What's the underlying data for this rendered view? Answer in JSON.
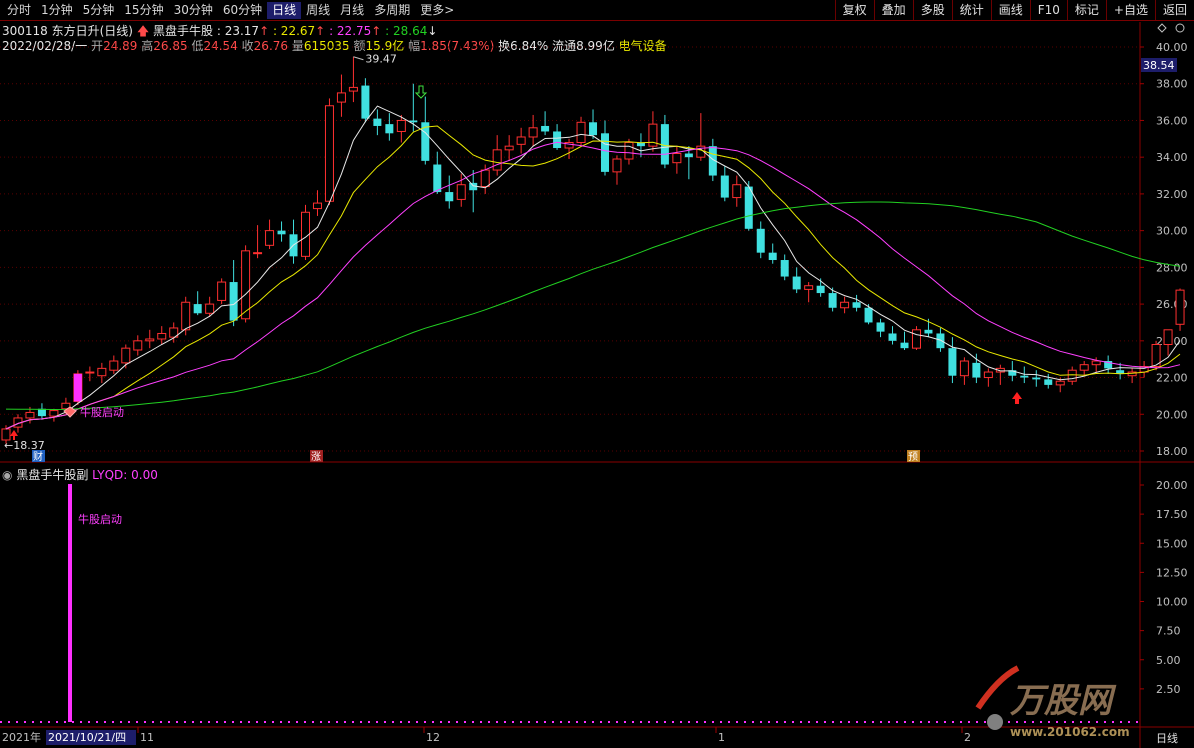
{
  "toolbar": {
    "periods": [
      "分时",
      "1分钟",
      "5分钟",
      "15分钟",
      "30分钟",
      "60分钟",
      "日线",
      "周线",
      "月线",
      "多周期",
      "更多>"
    ],
    "active_period": "日线",
    "actions": [
      "复权",
      "叠加",
      "多股",
      "统计",
      "画线",
      "F10",
      "标记",
      "+自选",
      "返回"
    ]
  },
  "stock": {
    "code_name": "300118 东方日升(日线)",
    "indicator_name": "黑盘手牛股",
    "v1": ": 23.17",
    "v2": ": 22.67",
    "v3": ": 22.75",
    "v4": ": 28.64"
  },
  "quote": {
    "date": "2022/02/28/一",
    "open_label": "开",
    "open": "24.89",
    "high_label": "高",
    "high": "26.85",
    "low_label": "低",
    "low": "24.54",
    "close_label": "收",
    "close": "26.76",
    "vol_label": "量",
    "vol": "615035",
    "amt_label": "额",
    "amt": "15.9亿",
    "chg_label": "幅",
    "chg": "1.85(7.43%)",
    "turnover": "换6.84%",
    "float": "流通8.99亿",
    "sector": "电气设备"
  },
  "main_chart": {
    "y_ticks": [
      "40.00",
      "38.00",
      "36.00",
      "34.00",
      "32.00",
      "30.00",
      "28.00",
      "26.00",
      "24.00",
      "22.00",
      "20.00",
      "18.00"
    ],
    "current_price": "38.54",
    "high_label": "39.47",
    "low_label": "18.37",
    "signal_label": "牛股启动",
    "markers": [
      "财",
      "涨",
      "预"
    ],
    "colors": {
      "up": "#ff3030",
      "down": "#40e0e0",
      "ma5": "#e8e8e8",
      "ma10": "#e8e800",
      "ma20": "#ff40ff",
      "ma60": "#22d022"
    }
  },
  "sub_chart": {
    "title": "黑盘手牛股副",
    "value_label": "LYQD: 0.00",
    "signal_label": "牛股启动",
    "y_ticks": [
      "20.00",
      "17.50",
      "15.00",
      "12.50",
      "10.00",
      "7.50",
      "5.00",
      "2.50"
    ]
  },
  "x_axis": {
    "year": "2021年",
    "cursor_date": "2021/10/21/四",
    "months": [
      "11",
      "12",
      "1",
      "2"
    ],
    "period_label": "日线"
  },
  "watermark": {
    "text": "万股网",
    "url_text": "www.201062.com"
  },
  "chart_data": {
    "type": "candlestick",
    "series": [
      {
        "name": "candles",
        "values": [
          [
            18.6,
            19.4,
            18.4,
            19.2
          ],
          [
            19.3,
            20.0,
            19.0,
            19.8
          ],
          [
            19.8,
            20.4,
            19.5,
            20.1
          ],
          [
            20.3,
            20.6,
            19.7,
            19.9
          ],
          [
            19.9,
            20.3,
            19.6,
            20.2
          ],
          [
            20.3,
            20.9,
            20.0,
            20.6
          ],
          [
            20.7,
            22.4,
            20.5,
            22.2
          ],
          [
            22.3,
            22.6,
            21.8,
            22.3
          ],
          [
            22.1,
            22.8,
            21.7,
            22.5
          ],
          [
            22.4,
            23.2,
            22.2,
            22.9
          ],
          [
            22.8,
            23.8,
            22.5,
            23.6
          ],
          [
            23.5,
            24.3,
            23.2,
            24.0
          ],
          [
            24.0,
            24.6,
            23.6,
            24.1
          ],
          [
            24.1,
            24.8,
            23.8,
            24.4
          ],
          [
            24.2,
            25.0,
            23.9,
            24.7
          ],
          [
            24.6,
            26.4,
            24.3,
            26.1
          ],
          [
            26.0,
            26.7,
            25.4,
            25.5
          ],
          [
            25.5,
            26.4,
            25.3,
            26.0
          ],
          [
            26.2,
            27.4,
            26.0,
            27.2
          ],
          [
            27.2,
            28.4,
            24.8,
            25.1
          ],
          [
            25.2,
            29.2,
            25.0,
            28.9
          ],
          [
            28.8,
            30.3,
            28.5,
            28.8
          ],
          [
            29.2,
            30.6,
            29.0,
            30.0
          ],
          [
            30.0,
            30.5,
            29.4,
            29.8
          ],
          [
            29.8,
            30.6,
            28.2,
            28.6
          ],
          [
            28.6,
            31.4,
            28.4,
            31.0
          ],
          [
            31.2,
            32.2,
            30.8,
            31.5
          ],
          [
            31.6,
            37.2,
            31.4,
            36.8
          ],
          [
            37.0,
            38.5,
            36.2,
            37.5
          ],
          [
            37.6,
            39.47,
            37.0,
            37.8
          ],
          [
            37.9,
            38.3,
            35.9,
            36.1
          ],
          [
            36.1,
            36.6,
            35.2,
            35.7
          ],
          [
            35.8,
            36.4,
            34.9,
            35.3
          ],
          [
            35.4,
            36.3,
            34.8,
            36.0
          ],
          [
            36.0,
            38.0,
            35.4,
            35.9
          ],
          [
            35.9,
            37.3,
            33.6,
            33.8
          ],
          [
            33.6,
            34.3,
            32.0,
            32.1
          ],
          [
            32.1,
            33.0,
            31.2,
            31.6
          ],
          [
            31.7,
            33.1,
            31.3,
            32.5
          ],
          [
            32.6,
            33.3,
            31.0,
            32.2
          ],
          [
            32.4,
            33.6,
            32.0,
            33.3
          ],
          [
            33.3,
            35.2,
            33.0,
            34.4
          ],
          [
            34.4,
            35.2,
            33.8,
            34.6
          ],
          [
            34.7,
            35.6,
            34.2,
            35.1
          ],
          [
            35.1,
            36.3,
            34.6,
            35.6
          ],
          [
            35.7,
            36.5,
            35.2,
            35.4
          ],
          [
            35.4,
            35.8,
            34.4,
            34.5
          ],
          [
            34.5,
            35.0,
            33.9,
            34.8
          ],
          [
            34.8,
            36.2,
            34.6,
            35.9
          ],
          [
            35.9,
            36.6,
            35.0,
            35.2
          ],
          [
            35.3,
            36.0,
            33.0,
            33.2
          ],
          [
            33.2,
            34.1,
            32.5,
            33.9
          ],
          [
            33.9,
            35.0,
            33.6,
            34.8
          ],
          [
            34.8,
            35.3,
            34.0,
            34.6
          ],
          [
            34.6,
            36.5,
            34.3,
            35.8
          ],
          [
            35.8,
            36.3,
            33.4,
            33.6
          ],
          [
            33.7,
            34.6,
            33.1,
            34.2
          ],
          [
            34.2,
            34.6,
            32.8,
            34.0
          ],
          [
            34.0,
            36.4,
            33.8,
            34.6
          ],
          [
            34.6,
            35.0,
            32.7,
            33.0
          ],
          [
            33.0,
            33.5,
            31.6,
            31.8
          ],
          [
            31.8,
            33.0,
            31.3,
            32.5
          ],
          [
            32.4,
            32.7,
            30.0,
            30.1
          ],
          [
            30.1,
            30.5,
            28.5,
            28.8
          ],
          [
            28.8,
            29.3,
            28.2,
            28.4
          ],
          [
            28.4,
            28.7,
            27.3,
            27.5
          ],
          [
            27.5,
            28.0,
            26.6,
            26.8
          ],
          [
            26.8,
            27.2,
            26.1,
            27.0
          ],
          [
            27.0,
            27.4,
            26.4,
            26.6
          ],
          [
            26.6,
            26.9,
            25.6,
            25.8
          ],
          [
            25.8,
            26.4,
            25.5,
            26.1
          ],
          [
            26.1,
            26.5,
            25.6,
            25.8
          ],
          [
            25.8,
            26.0,
            24.9,
            25.0
          ],
          [
            25.0,
            25.2,
            24.2,
            24.5
          ],
          [
            24.4,
            24.8,
            23.8,
            24.0
          ],
          [
            23.9,
            24.5,
            23.5,
            23.6
          ],
          [
            23.6,
            24.8,
            23.5,
            24.6
          ],
          [
            24.6,
            25.2,
            24.2,
            24.4
          ],
          [
            24.4,
            24.7,
            23.4,
            23.6
          ],
          [
            23.6,
            24.2,
            21.7,
            22.1
          ],
          [
            22.1,
            23.1,
            21.6,
            22.9
          ],
          [
            22.8,
            23.3,
            21.7,
            22.0
          ],
          [
            22.0,
            22.5,
            21.5,
            22.3
          ],
          [
            22.3,
            22.7,
            21.6,
            22.5
          ],
          [
            22.4,
            22.9,
            21.8,
            22.1
          ],
          [
            22.1,
            22.6,
            21.7,
            22.0
          ],
          [
            22.0,
            22.4,
            21.5,
            21.9
          ],
          [
            21.9,
            22.2,
            21.4,
            21.6
          ],
          [
            21.6,
            22.0,
            21.2,
            21.8
          ],
          [
            21.8,
            22.6,
            21.6,
            22.4
          ],
          [
            22.4,
            22.9,
            22.1,
            22.7
          ],
          [
            22.7,
            23.1,
            22.3,
            22.9
          ],
          [
            22.9,
            23.2,
            22.2,
            22.5
          ],
          [
            22.4,
            22.8,
            21.9,
            22.2
          ],
          [
            22.1,
            22.5,
            21.7,
            22.3
          ],
          [
            22.3,
            22.9,
            22.0,
            22.6
          ],
          [
            22.6,
            24.0,
            22.4,
            23.8
          ],
          [
            23.8,
            24.6,
            23.2,
            24.6
          ],
          [
            24.9,
            26.85,
            24.54,
            26.76
          ]
        ]
      },
      {
        "name": "MA5"
      },
      {
        "name": "MA10"
      },
      {
        "name": "MA20"
      },
      {
        "name": "MA60"
      }
    ],
    "ylim": [
      18.0,
      40.0
    ]
  }
}
